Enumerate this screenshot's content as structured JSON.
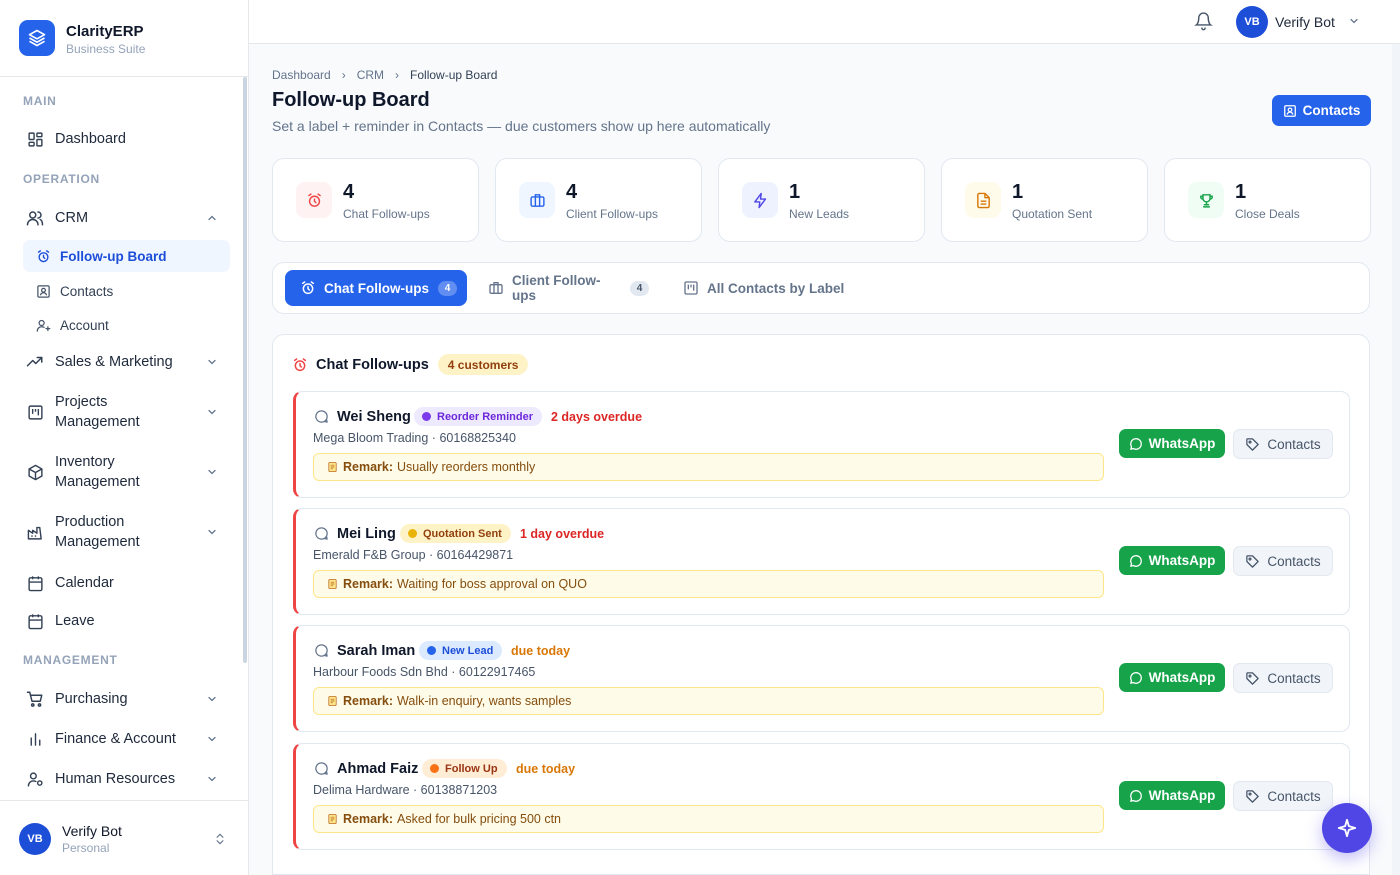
{
  "brand": {
    "name": "ClarityERP",
    "subtitle": "Business Suite"
  },
  "sidebar": {
    "sections": {
      "main": "MAIN",
      "operation": "OPERATION",
      "management": "MANAGEMENT"
    },
    "items": {
      "dashboard": "Dashboard",
      "crm": "CRM",
      "followup_board": "Follow-up Board",
      "contacts": "Contacts",
      "account": "Account",
      "sales": "Sales & Marketing",
      "projects_1": "Projects",
      "projects_2": "Management",
      "inventory_1": "Inventory",
      "inventory_2": "Management",
      "production_1": "Production",
      "production_2": "Management",
      "calendar": "Calendar",
      "leave": "Leave",
      "purchasing": "Purchasing",
      "finance": "Finance & Account",
      "hr": "Human Resources"
    },
    "footer_user": {
      "initials": "VB",
      "name": "Verify Bot",
      "role": "Personal"
    }
  },
  "topbar": {
    "user_initials": "VB",
    "user_name": "Verify Bot"
  },
  "breadcrumb": [
    "Dashboard",
    "CRM",
    "Follow-up Board"
  ],
  "page": {
    "title": "Follow-up Board",
    "subtitle": "Set a label + reminder in Contacts — due customers show up here automatically",
    "contacts_button": "Contacts"
  },
  "stats": [
    {
      "value": "4",
      "label": "Chat Follow-ups",
      "icon": "alarm-icon",
      "color": "#ef4444",
      "bg": "#fef2f2"
    },
    {
      "value": "4",
      "label": "Client Follow-ups",
      "icon": "briefcase-icon",
      "color": "#2563eb",
      "bg": "#eff6ff"
    },
    {
      "value": "1",
      "label": "New Leads",
      "icon": "bolt-icon",
      "color": "#4f46e5",
      "bg": "#eef2ff"
    },
    {
      "value": "1",
      "label": "Quotation Sent",
      "icon": "document-icon",
      "color": "#d97706",
      "bg": "#fffbeb"
    },
    {
      "value": "1",
      "label": "Close Deals",
      "icon": "trophy-icon",
      "color": "#16a34a",
      "bg": "#f0fdf4"
    }
  ],
  "tabs": [
    {
      "label": "Chat Follow-ups",
      "count": "4",
      "active": true
    },
    {
      "label": "Client Follow-ups",
      "count": "4",
      "active": false
    },
    {
      "label": "All Contacts by Label",
      "active": false
    }
  ],
  "panel": {
    "title": "Chat Follow-ups",
    "badge": "4 customers"
  },
  "remark_label": "Remark:",
  "whatsapp_label": "WhatsApp",
  "contacts_label": "Contacts",
  "followups": [
    {
      "name": "Wei Sheng",
      "tag": "Reorder Reminder",
      "tag_color": "#7c3aed",
      "tag_bg": "#ede9fe",
      "tag_text": "#6d28d9",
      "due": "2 days overdue",
      "due_color": "#dc2626",
      "company": "Mega Bloom Trading · 60168825340",
      "remark": "Usually reorders monthly"
    },
    {
      "name": "Mei Ling",
      "tag": "Quotation Sent",
      "tag_color": "#eab308",
      "tag_bg": "#fef3c7",
      "tag_text": "#92400e",
      "due": "1 day overdue",
      "due_color": "#dc2626",
      "company": "Emerald F&B Group · 60164429871",
      "remark": "Waiting for boss approval on QUO"
    },
    {
      "name": "Sarah Iman",
      "tag": "New Lead",
      "tag_color": "#2563eb",
      "tag_bg": "#dbeafe",
      "tag_text": "#1d4ed8",
      "due": "due today",
      "due_color": "#d97706",
      "company": "Harbour Foods Sdn Bhd · 60122917465",
      "remark": "Walk-in enquiry, wants samples"
    },
    {
      "name": "Ahmad Faiz",
      "tag": "Follow Up",
      "tag_color": "#f97316",
      "tag_bg": "#ffedd5",
      "tag_text": "#9a3412",
      "due": "due today",
      "due_color": "#d97706",
      "company": "Delima Hardware · 60138871203",
      "remark": "Asked for bulk pricing 500 ctn"
    }
  ]
}
